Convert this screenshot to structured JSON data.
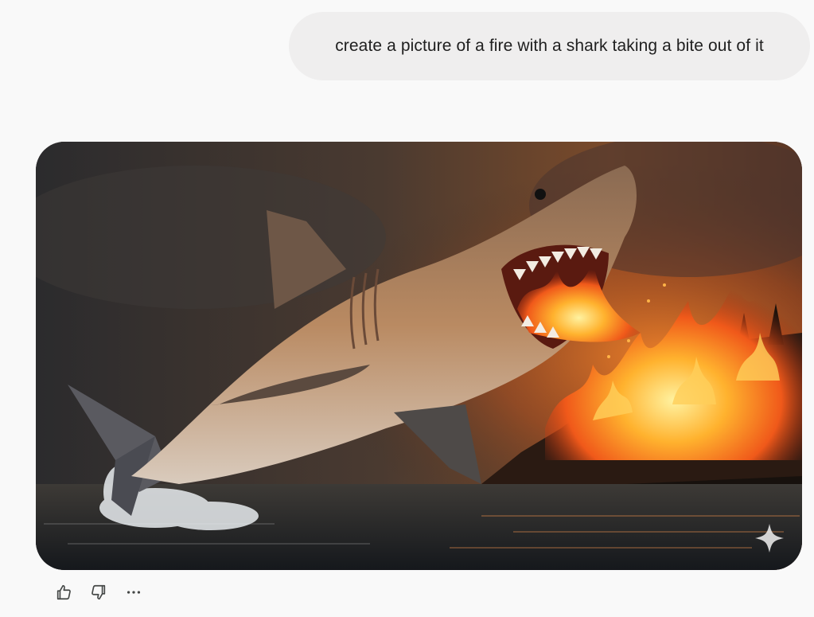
{
  "conversation": {
    "user_prompt": "create a picture of a fire with a shark taking a bite out of it"
  },
  "response": {
    "image": {
      "subject": "Great white shark leaping from the ocean biting into a burning forest fire",
      "watermark_icon": "sparkle-icon"
    },
    "actions": [
      {
        "name": "thumbs-up-icon"
      },
      {
        "name": "thumbs-down-icon"
      },
      {
        "name": "more-options-icon"
      }
    ]
  },
  "colors": {
    "page_bg": "#f9f9f9",
    "bubble_bg": "#efeeee",
    "text": "#1f1f1f",
    "icon": "#444746"
  }
}
